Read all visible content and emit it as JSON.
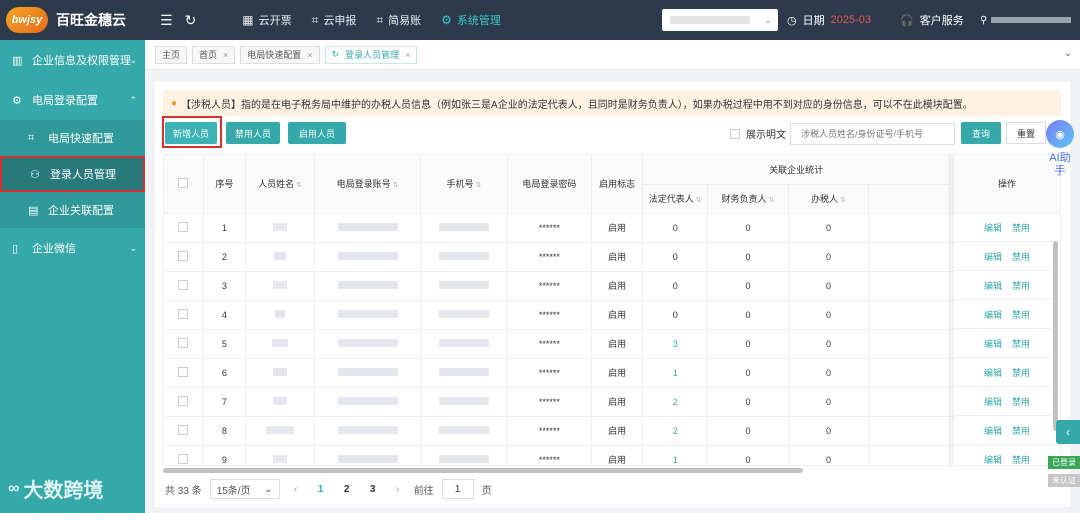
{
  "app": {
    "logo_badge": "bwjsy",
    "title": "百旺金穗云"
  },
  "nav": [
    {
      "label": "云开票",
      "icon": "grid-icon",
      "active": false
    },
    {
      "label": "云申报",
      "icon": "crop-icon",
      "active": false
    },
    {
      "label": "简易账",
      "icon": "crop-icon",
      "active": false
    },
    {
      "label": "系统管理",
      "icon": "gear-icon",
      "active": true
    }
  ],
  "header": {
    "date_label": "日期",
    "date_value": "2025-03",
    "service_label": "客户服务"
  },
  "sidebar": {
    "items": [
      {
        "label": "企业信息及权限管理"
      },
      {
        "label": "电局登录配置"
      },
      {
        "label": "电局快速配置"
      },
      {
        "label": "登录人员管理"
      },
      {
        "label": "企业关联配置"
      },
      {
        "label": "企业微信"
      }
    ],
    "watermark": "大数跨境"
  },
  "tabs": [
    {
      "label": "主页"
    },
    {
      "label": "首页"
    },
    {
      "label": "电局快速配置"
    },
    {
      "label": "登录人员管理"
    }
  ],
  "notice": "【涉税人员】指的是在电子税务局中维护的办税人员信息（例如张三是A企业的法定代表人，且同时是财务负责人），如果办税过程中用不到对应的身份信息，可以不在此模块配置。",
  "toolbar": {
    "add_label": "新增人员",
    "disable_label": "禁用人员",
    "enable_label": "启用人员",
    "show_plain_label": "展示明文",
    "search_placeholder": "涉税人员姓名/身份证号/手机号",
    "query_label": "查询",
    "reset_label": "重置"
  },
  "table": {
    "headers": {
      "seq": "序号",
      "name": "人员姓名",
      "account": "电局登录账号",
      "phone": "手机号",
      "password": "电局登录密码",
      "status": "启用标志",
      "group": "关联企业统计",
      "legal": "法定代表人",
      "finance": "财务负责人",
      "tax": "办税人",
      "ops": "操作"
    },
    "rows": [
      {
        "seq": "1",
        "password": "******",
        "status": "启用",
        "legal": "0",
        "finance": "0",
        "tax": "0"
      },
      {
        "seq": "2",
        "password": "******",
        "status": "启用",
        "legal": "0",
        "finance": "0",
        "tax": "0"
      },
      {
        "seq": "3",
        "password": "******",
        "status": "启用",
        "legal": "0",
        "finance": "0",
        "tax": "0"
      },
      {
        "seq": "4",
        "password": "******",
        "status": "启用",
        "legal": "0",
        "finance": "0",
        "tax": "0"
      },
      {
        "seq": "5",
        "password": "******",
        "status": "启用",
        "legal": "3",
        "finance": "0",
        "tax": "0"
      },
      {
        "seq": "6",
        "password": "******",
        "status": "启用",
        "legal": "1",
        "finance": "0",
        "tax": "0"
      },
      {
        "seq": "7",
        "password": "******",
        "status": "启用",
        "legal": "2",
        "finance": "0",
        "tax": "0"
      },
      {
        "seq": "8",
        "password": "******",
        "status": "启用",
        "legal": "2",
        "finance": "0",
        "tax": "0"
      },
      {
        "seq": "9",
        "password": "******",
        "status": "启用",
        "legal": "1",
        "finance": "0",
        "tax": "0"
      }
    ],
    "op_edit": "编辑",
    "op_disable": "禁用"
  },
  "pager": {
    "total": "共 33 条",
    "page_size": "15条/页",
    "pages": [
      "1",
      "2",
      "3"
    ],
    "goto_label": "前往",
    "goto_value": "1",
    "page_suffix": "页"
  },
  "float": {
    "ai_label": "AI助手",
    "logged": "已登录",
    "unverified": "未认证"
  },
  "colors": {
    "accent": "#35a8a9",
    "topbar": "#2d3a4b",
    "highlight": "#d9302f"
  }
}
